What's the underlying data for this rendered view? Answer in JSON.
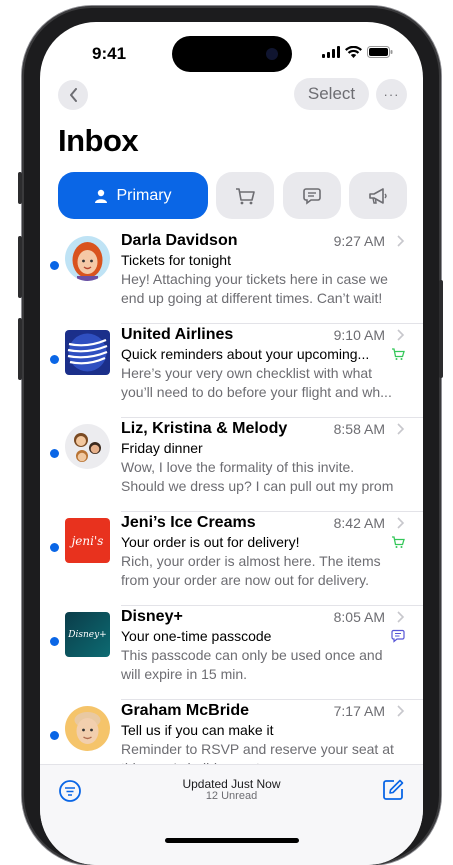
{
  "status": {
    "time": "9:41"
  },
  "nav": {
    "select_label": "Select",
    "more_label": "···"
  },
  "inbox": {
    "title": "Inbox"
  },
  "tabs": {
    "primary_label": "Primary"
  },
  "colors": {
    "accent": "#0a66e6",
    "transactions": "#34c759",
    "updates": "#5856d6",
    "secondary_text": "#6d6d72"
  },
  "messages": [
    {
      "sender": "Darla Davidson",
      "time": "9:27 AM",
      "subject": "Tickets for tonight",
      "preview": "Hey! Attaching your tickets here in case we end up going at different times. Can’t wait!",
      "avatar": "memoji-woman-icon",
      "category_icon": ""
    },
    {
      "sender": "United Airlines",
      "time": "9:10 AM",
      "subject": "Quick reminders about your upcoming...",
      "preview": "Here’s your very own checklist with what you’ll need to do before your flight and wh...",
      "avatar": "united-logo-icon",
      "category_icon": "cart-icon"
    },
    {
      "sender": "Liz, Kristina & Melody",
      "time": "8:58 AM",
      "subject": "Friday dinner",
      "preview": "Wow, I love the formality of this invite. Should we dress up? I can pull out my prom dress...",
      "avatar": "group-memoji-icon",
      "category_icon": ""
    },
    {
      "sender": "Jeni’s Ice Creams",
      "time": "8:42 AM",
      "subject": "Your order is out for delivery!",
      "preview": "Rich, your order is almost here. The items from your order are now out for delivery.",
      "avatar": "jenis-logo-icon",
      "avatar_text": "jeni's",
      "category_icon": "cart-icon"
    },
    {
      "sender": "Disney+",
      "time": "8:05 AM",
      "subject": "Your one-time passcode",
      "preview": "This passcode can only be used once and will expire in 15 min.",
      "avatar": "disney-plus-logo-icon",
      "avatar_text": "Disney+",
      "category_icon": "message-icon"
    },
    {
      "sender": "Graham McBride",
      "time": "7:17 AM",
      "subject": "Tell us if you can make it",
      "preview": "Reminder to RSVP and reserve your seat at this year's holiday party.",
      "avatar": "memoji-man-icon",
      "category_icon": ""
    }
  ],
  "bottom": {
    "updated": "Updated Just Now",
    "unread": "12 Unread"
  }
}
